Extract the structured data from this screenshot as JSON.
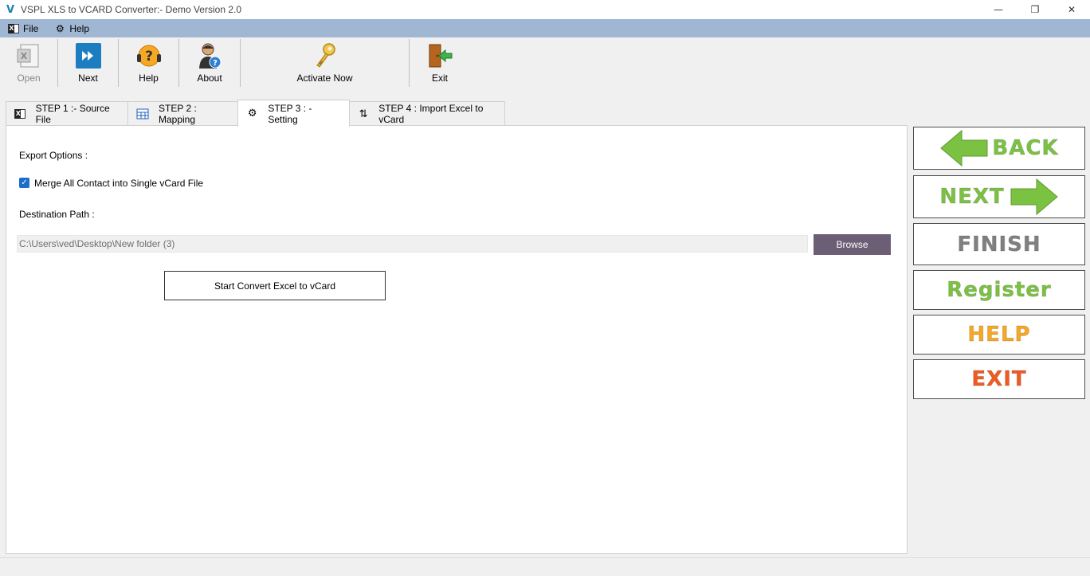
{
  "window": {
    "title": "VSPL XLS to VCARD Converter:- Demo Version 2.0",
    "logo_letter": "V",
    "minimize": "—",
    "restore": "❐",
    "close": "✕"
  },
  "menu": {
    "file": "File",
    "help": "Help"
  },
  "toolbar": {
    "open": "Open",
    "next": "Next",
    "help": "Help",
    "about": "About",
    "activate": "Activate Now",
    "exit": "Exit"
  },
  "tabs": [
    {
      "label": "STEP 1 :- Source File"
    },
    {
      "label": "STEP 2 : Mapping"
    },
    {
      "label": "STEP 3 : - Setting"
    },
    {
      "label": "STEP 4 : Import Excel to vCard"
    }
  ],
  "settings": {
    "export_options_label": "Export Options :",
    "merge_checkbox_label": "Merge All Contact into Single vCard File",
    "merge_checked": true,
    "destination_label": "Destination Path :",
    "destination_value": "C:\\Users\\ved\\Desktop\\New folder (3)",
    "browse_label": "Browse",
    "convert_label": "Start Convert Excel to vCard"
  },
  "side_buttons": {
    "back": "BACK",
    "next": "NEXT",
    "finish": "FINISH",
    "register": "Register",
    "help": "HELP",
    "exit": "EXIT"
  },
  "colors": {
    "menubar": "#9fb7d3",
    "green": "#7cc242",
    "gray": "#808080",
    "orange": "#f7a823",
    "red": "#f15a22",
    "browse": "#6b5e75"
  }
}
